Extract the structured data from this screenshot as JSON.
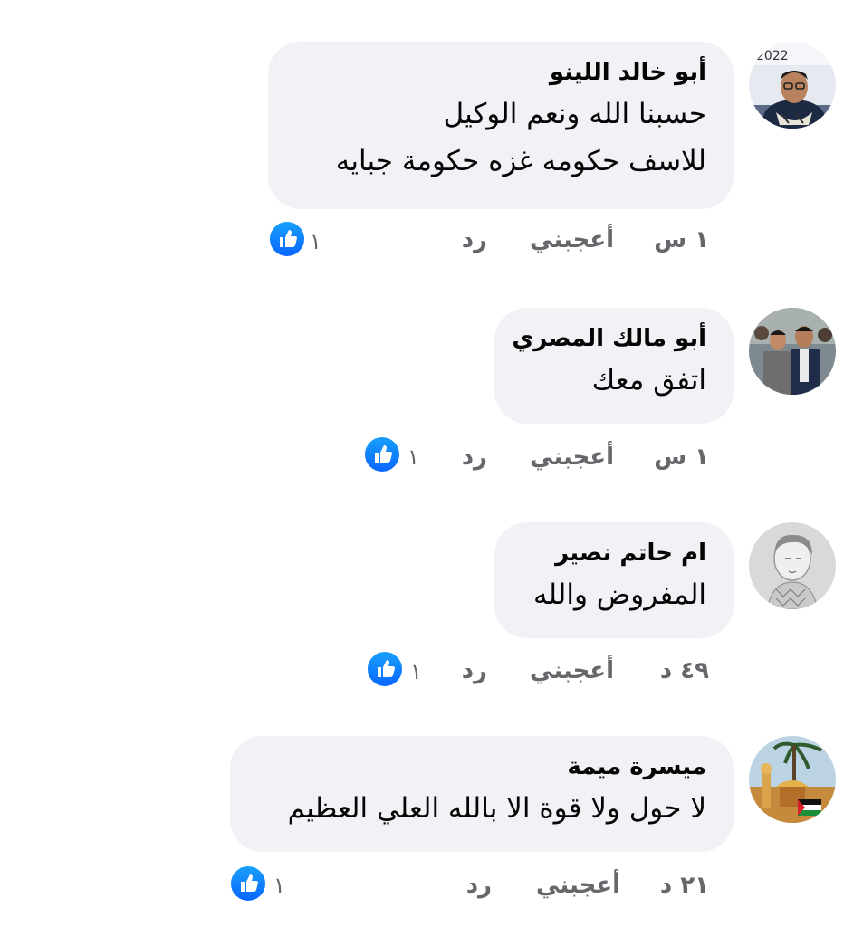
{
  "comments": [
    {
      "author": "أبو خالد اللينو",
      "lines": [
        "حسبنا الله ونعم الوكيل",
        "للاسف حكومه غزه حكومة جبايه"
      ],
      "time": "١ س",
      "like_label": "أعجبني",
      "reply_label": "رد",
      "reactions": "١",
      "avatar_badge": "2022"
    },
    {
      "author": "أبو مالك المصري",
      "lines": [
        "اتفق معك"
      ],
      "time": "١ س",
      "like_label": "أعجبني",
      "reply_label": "رد",
      "reactions": "١"
    },
    {
      "author": "ام حاتم نصير",
      "lines": [
        "المفروض والله"
      ],
      "time": "٤٩ د",
      "like_label": "أعجبني",
      "reply_label": "رد",
      "reactions": "١"
    },
    {
      "author": "ميسرة ميمة",
      "lines": [
        "لا حول ولا قوة الا بالله العلي العظيم"
      ],
      "time": "٢١ د",
      "like_label": "أعجبني",
      "reply_label": "رد",
      "reactions": "١"
    }
  ],
  "colors": {
    "bubble": "#f0f2f5",
    "text": "#050505",
    "secondary": "#65676b",
    "like_blue": "#0866ff"
  },
  "icons": {
    "reaction": "thumbs-up-icon"
  }
}
